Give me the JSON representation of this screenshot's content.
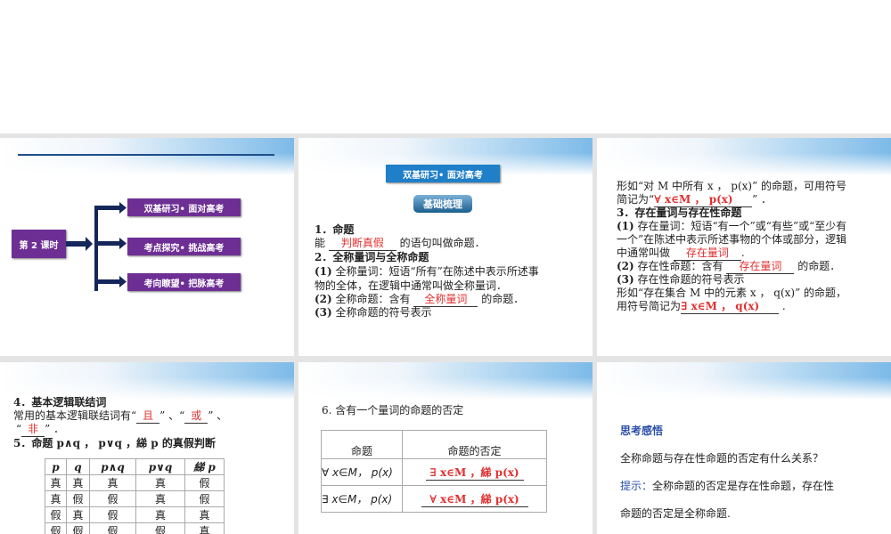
{
  "slide1": {
    "center": "第 2 课时",
    "branches": [
      "双基研习• 面对高考",
      "考点探究• 挑战高考",
      "考向瞭望• 把脉高考"
    ]
  },
  "slide2": {
    "header": "双基研习• 面对高考",
    "badge": "基础梳理",
    "l1": "1．命题",
    "l2a": "能",
    "l2blank": "判断真假",
    "l2b": "的语句叫做命题．",
    "l3": "2．全称量词与全称命题",
    "l4a": "(1)",
    "l4b": " 全称量词：短语“所有”在陈述中表示所述事",
    "l5": "物的全体，在逻辑中通常叫做全称量词．",
    "l6a": "(2)",
    "l6b": " 全称命题：含有",
    "l6blank": "全称量词",
    "l6c": " 的命题．",
    "l7a": "(3)",
    "l7b": " 全称命题的符号表示"
  },
  "slide3": {
    "l1": "形如“对 M 中所有 x ， p(x)” 的命题，可用符号",
    "l2a": "简记为“",
    "l2blank": "∀ x∈M ， p(x)",
    "l2b": "” ．",
    "l3": "3．存在量词与存在性命题",
    "l4a": "(1)",
    "l4b": " 存在量词：短语“有一个”或“有些”或“至少有",
    "l5": "一个”在陈述中表示所述事物的个体或部分，逻辑",
    "l6a": "中通常叫做",
    "l6blank": "存在量词",
    "l6b": ".",
    "l7a": "(2)",
    "l7b": " 存在性命题：含有",
    "l7blank": "存在量词",
    "l7c": " 的命题．",
    "l8a": "(3)",
    "l8b": " 存在性命题的符号表示",
    "l9": "形如“存在集合 M 中的元素 x ， q(x)” 的命题，",
    "l10a": "用符号简记为",
    "l10blank": "∃ x∈M ， q(x)",
    "l10b": " ."
  },
  "slide4": {
    "l1": "4．基本逻辑联结词",
    "l2a": "常用的基本逻辑联结词有“",
    "l2blank1": "且",
    "l2b": "” 、“",
    "l2blank2": "或",
    "l2c": "” 、",
    "l3a": "“",
    "l3blank": "非",
    "l3b": "” ．",
    "l4": "5．命题 p∧q ， p∨q ，綈 p 的真假判断",
    "table": {
      "headers": [
        "p",
        "q",
        "p∧q",
        "p∨q",
        "綈 p"
      ],
      "rows": [
        [
          "真",
          "真",
          "真",
          "真",
          "假"
        ],
        [
          "真",
          "假",
          "假",
          "真",
          "假"
        ],
        [
          "假",
          "真",
          "假",
          "真",
          "真"
        ],
        [
          "假",
          "假",
          "假",
          "假",
          "真"
        ]
      ]
    }
  },
  "slide5": {
    "title": "6. 含有一个量词的命题的否定",
    "headers": [
      "命题",
      "命题的否定"
    ],
    "rows": [
      [
        "∀ x∈M， p(x)",
        "∃ x∈M ，綈 p(x)"
      ],
      [
        "∃ x∈M， p(x)",
        "∀ x∈M ，綈 p(x)"
      ]
    ]
  },
  "slide6": {
    "title": "思考感悟",
    "question": "全称命题与存在性命题的否定有什么关系？",
    "hint_label": "提示：",
    "hint1": "全称命题的否定是存在性命题，存在性",
    "hint2": "命题的否定是全称命题."
  }
}
